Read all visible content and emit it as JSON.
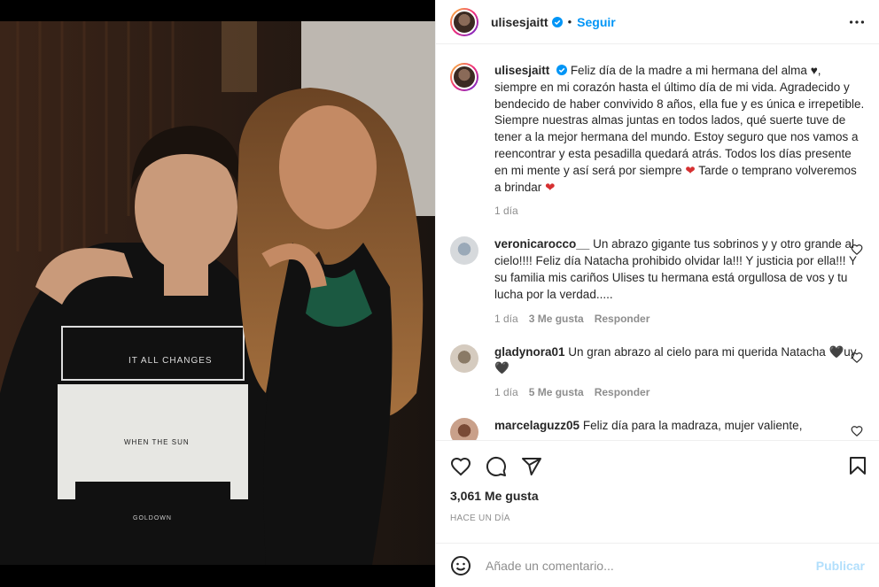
{
  "post": {
    "username": "ulisesjaitt",
    "follow_label": "Seguir",
    "dot": "•",
    "caption": "Feliz día de la madre a mi hermana del alma ♥, siempre en mi corazón hasta el último día de mi vida. Agradecido y bendecido de haber convivido 8 años, ella fue y es única e irrepetible. Siempre nuestras almas juntas en todos lados, qué suerte tuve de tener a la mejor hermana del mundo. Estoy seguro que nos vamos a reencontrar y esta pesadilla quedará atrás. Todos los días presente en mi mente y así será por siempre",
    "caption_end": "Tarde o temprano volveremos a brindar",
    "caption_time": "1 día",
    "shirt_top": "IT ALL CHANGES",
    "shirt_mid": "WHEN THE SUN",
    "shirt_bottom": "GOLDOWN"
  },
  "comments": [
    {
      "username": "veronicarocco__",
      "text": "Un abrazo gigante tus sobrinos y y otro grande al cielo!!!! Feliz día Natacha prohibido olvidar la!!! Y justicia por ella!!! Y su familia mis cariños Ulises tu hermana está orgullosa de vos y tu lucha por la verdad.....",
      "time": "1 día",
      "likes": "3 Me gusta",
      "reply": "Responder"
    },
    {
      "username": "gladynora01",
      "text": "Un gran abrazo al cielo para mi querida Natacha",
      "text_end": "🖤uy🖤",
      "time": "1 día",
      "likes": "5 Me gusta",
      "reply": "Responder"
    },
    {
      "username": "marcelaguzz05",
      "text": "Feliz día para la madraza, mujer valiente,",
      "time": "",
      "likes": "",
      "reply": ""
    }
  ],
  "actions": {
    "likes_count": "3,061 Me gusta",
    "time_ago": "HACE UN DÍA"
  },
  "add_comment": {
    "placeholder": "Añade un comentario...",
    "publish_label": "Publicar"
  },
  "colors": {
    "link_blue": "#0095f6",
    "publish_disabled": "#b2dffc",
    "muted": "#8e8e8e",
    "heart_red": "#d63031"
  }
}
